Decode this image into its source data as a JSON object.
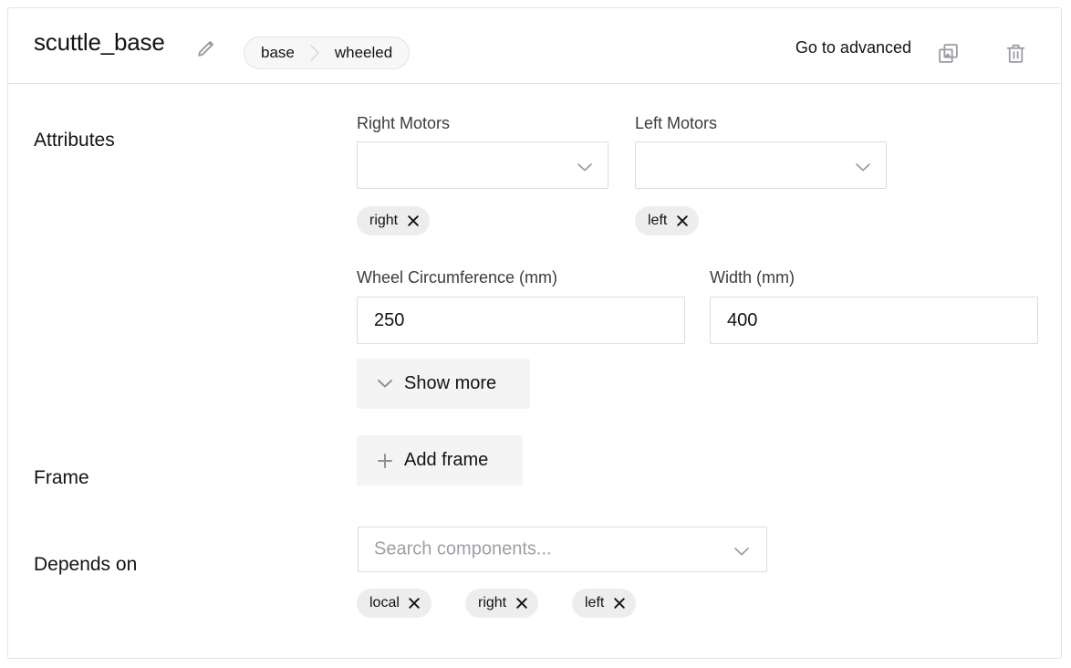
{
  "header": {
    "title": "scuttle_base",
    "edit_icon": "pencil-icon",
    "breadcrumb": {
      "items": [
        "base",
        "wheeled"
      ],
      "separator_icon": "chevron-right-icon"
    },
    "advanced_link": "Go to advanced",
    "duplicate_icon": "duplicate-icon",
    "delete_icon": "trash-icon"
  },
  "sections": {
    "attributes": {
      "label": "Attributes",
      "right_motors": {
        "label": "Right Motors",
        "value": "",
        "chevron_icon": "chevron-down-icon",
        "chips": [
          {
            "label": "right",
            "remove_icon": "close-icon"
          }
        ]
      },
      "left_motors": {
        "label": "Left Motors",
        "value": "",
        "chevron_icon": "chevron-down-icon",
        "chips": [
          {
            "label": "left",
            "remove_icon": "close-icon"
          }
        ]
      },
      "wheel_circumference": {
        "label": "Wheel Circumference (mm)",
        "value": "250"
      },
      "width": {
        "label": "Width (mm)",
        "value": "400"
      },
      "show_more": {
        "label": "Show more",
        "icon": "chevron-down-icon"
      }
    },
    "frame": {
      "label": "Frame",
      "add_button": {
        "label": "Add frame",
        "icon": "plus-icon"
      }
    },
    "depends_on": {
      "label": "Depends on",
      "search": {
        "value": "",
        "placeholder": "Search components...",
        "chevron_icon": "chevron-down-icon"
      },
      "chips": [
        {
          "label": "local",
          "remove_icon": "close-icon"
        },
        {
          "label": "right",
          "remove_icon": "close-icon"
        },
        {
          "label": "left",
          "remove_icon": "close-icon"
        }
      ]
    }
  },
  "colors": {
    "card_border": "#e4e4e4",
    "chip_bg": "#ededed",
    "button_bg": "#f4f4f4",
    "icon_gray": "#9a9aa2",
    "placeholder": "#9e9ea6",
    "text": "#131313"
  }
}
